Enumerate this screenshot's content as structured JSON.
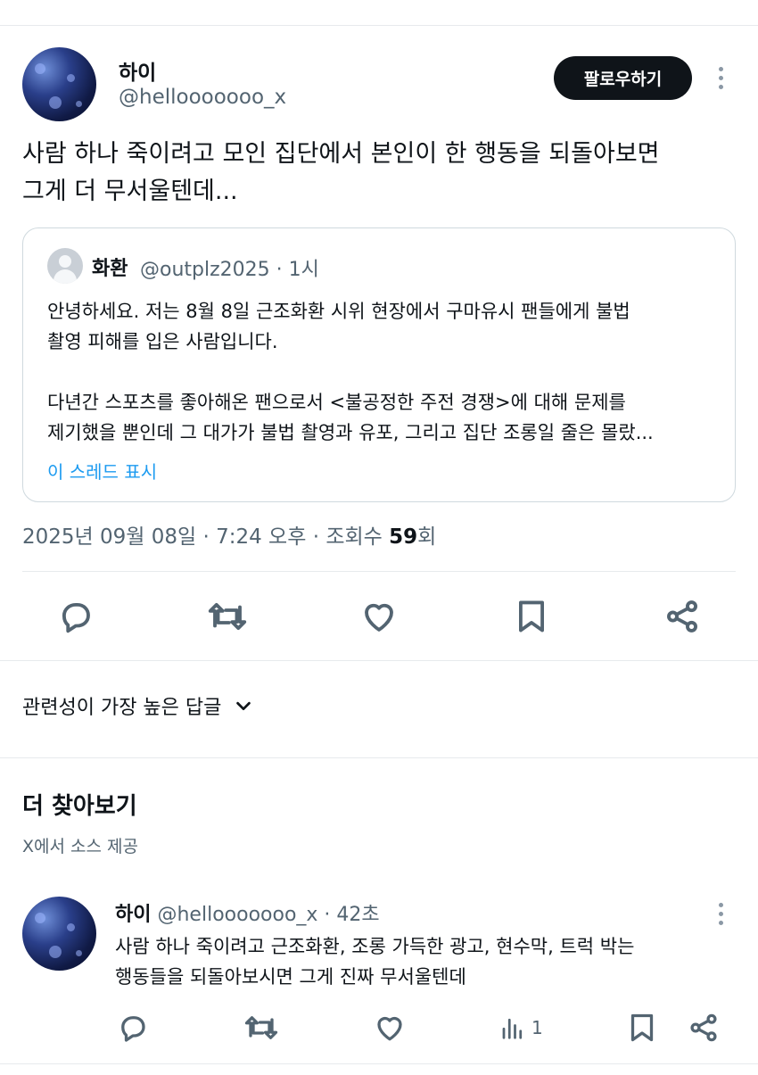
{
  "tweet": {
    "display_name": "하이",
    "handle": "@hellooooooo_x",
    "follow_label": "팔로우하기",
    "text_line1": "사람 하나 죽이려고 모인 집단에서 본인이 한 행동을 되돌아보면",
    "text_line2": "그게 더 무서울텐데...",
    "meta_date": "2025년 09월 08일 · 7:24 오후 · 조회수 ",
    "meta_views": "59",
    "meta_suffix": "회"
  },
  "quote": {
    "display_name": "화환",
    "handle_time": "@outplz2025 · 1시",
    "line1": "안녕하세요. 저는 8월 8일 근조화환 시위 현장에서 구마유시 팬들에게 불법",
    "line2": "촬영 피해를 입은 사람입니다.",
    "line3": "다년간 스포츠를 좋아해온 팬으로서 <불공정한 주전 경쟁>에 대해 문제를",
    "line4": "제기했을 뿐인데 그 대가가 불법 촬영과 유포, 그리고 집단 조롱일 줄은 몰랐...",
    "show_thread": "이 스레드 표시"
  },
  "sort": {
    "label": "관련성이 가장 높은 답글"
  },
  "discover": {
    "title": "더 찾아보기",
    "source": "X에서 소스 제공"
  },
  "reply": {
    "display_name": "하이",
    "handle_time": "@hellooooooo_x · 42초",
    "line1": "사람 하나 죽이려고 근조화환, 조롱 가득한 광고, 현수막, 트럭 박는",
    "line2": "행동들을 되돌아보시면 그게 진짜 무서울텐데",
    "views": "1"
  },
  "icons": [
    "reply-icon",
    "retweet-icon",
    "like-icon",
    "bookmark-icon",
    "share-icon",
    "views-icon",
    "more-icon",
    "chevron-down-icon"
  ]
}
